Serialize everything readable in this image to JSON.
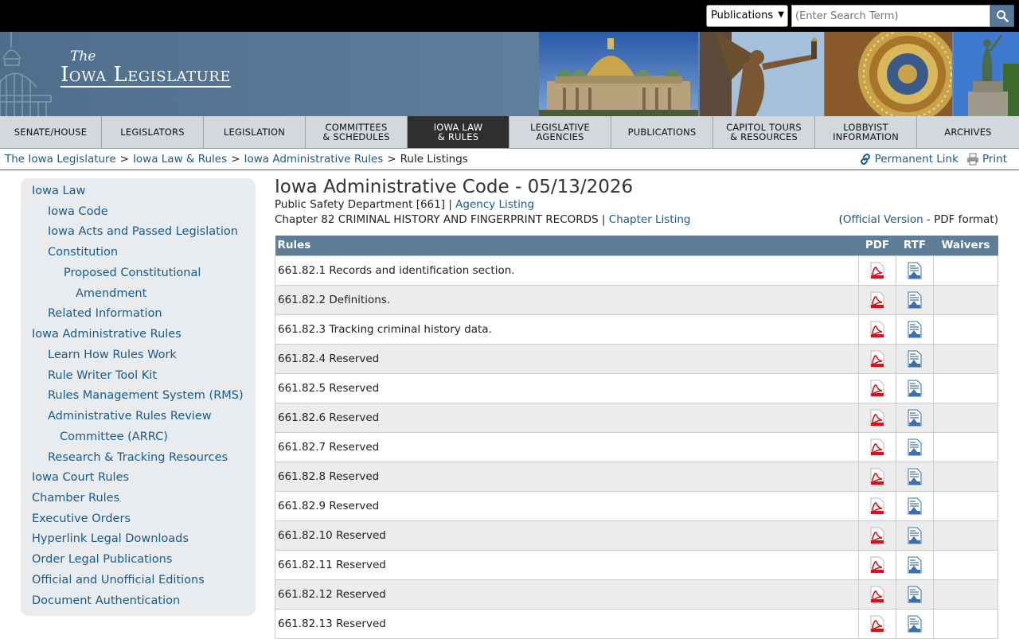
{
  "search": {
    "selected": "Publications",
    "placeholder": "(Enter Search Term)"
  },
  "logo": {
    "the": "The",
    "name": "Iowa Legislature"
  },
  "nav": [
    {
      "label": "SENATE/HOUSE"
    },
    {
      "label": "LEGISLATORS"
    },
    {
      "label": "LEGISLATION"
    },
    {
      "label": "COMMITTEES\n& SCHEDULES"
    },
    {
      "label": "IOWA LAW\n& RULES"
    },
    {
      "label": "LEGISLATIVE\nAGENCIES"
    },
    {
      "label": "PUBLICATIONS"
    },
    {
      "label": "CAPITOL TOURS\n& RESOURCES"
    },
    {
      "label": "LOBBYIST\nINFORMATION"
    },
    {
      "label": "ARCHIVES"
    }
  ],
  "breadcrumb": {
    "items": [
      "The Iowa Legislature",
      "Iowa Law & Rules",
      "Iowa Administrative Rules"
    ],
    "current": "Rule Listings",
    "separator": ">"
  },
  "tools": {
    "permanent_link": "Permanent Link",
    "print": "Print"
  },
  "sidebar": [
    {
      "label": "Iowa Law"
    },
    {
      "label": "Iowa Code"
    },
    {
      "label": "Iowa Acts and Passed Legislation"
    },
    {
      "label": "Constitution"
    },
    {
      "label": "Proposed Constitutional"
    },
    {
      "label": "Amendment"
    },
    {
      "label": "Related Information"
    },
    {
      "label": "Iowa Administrative Rules"
    },
    {
      "label": "Learn How Rules Work"
    },
    {
      "label": "Rule Writer Tool Kit"
    },
    {
      "label": "Rules Management System (RMS)"
    },
    {
      "label": "Administrative Rules Review"
    },
    {
      "label": "Committee (ARRC)"
    },
    {
      "label": "Research & Tracking Resources"
    },
    {
      "label": "Iowa Court Rules"
    },
    {
      "label": "Chamber Rules"
    },
    {
      "label": "Executive Orders"
    },
    {
      "label": "Hyperlink Legal Downloads"
    },
    {
      "label": "Order Legal Publications"
    },
    {
      "label": "Official and Unofficial Editions"
    },
    {
      "label": "Document Authentication"
    }
  ],
  "main": {
    "title": "Iowa Administrative Code - 05/13/2026",
    "department": "Public Safety Department [661]",
    "agency_link": "Agency Listing",
    "chapter": "Chapter 82 CRIMINAL HISTORY AND FINGERPRINT RECORDS",
    "chapter_link": "Chapter Listing",
    "official_open": "(",
    "official_link": "Official Version",
    "official_tail": " - PDF format)",
    "meta_separator": "|"
  },
  "table": {
    "headers": {
      "rules": "Rules",
      "pdf": "PDF",
      "rtf": "RTF",
      "waivers": "Waivers"
    },
    "rows": [
      "661.82.1 Records and identification section.",
      "661.82.2 Definitions.",
      "661.82.3 Tracking criminal history data.",
      "661.82.4 Reserved",
      "661.82.5 Reserved",
      "661.82.6 Reserved",
      "661.82.7 Reserved",
      "661.82.8 Reserved",
      "661.82.9 Reserved",
      "661.82.10 Reserved",
      "661.82.11 Reserved",
      "661.82.12 Reserved",
      "661.82.13 Reserved"
    ]
  },
  "colors": {
    "nav_active": "#2f2f2f",
    "table_header": "#5d7d99",
    "link": "#1a5a8c",
    "banner": "#5f7f9c"
  },
  "icons": [
    "search-icon",
    "link-icon",
    "printer-icon",
    "pdf-file-icon",
    "rtf-file-icon",
    "capitol-dome-icon"
  ]
}
